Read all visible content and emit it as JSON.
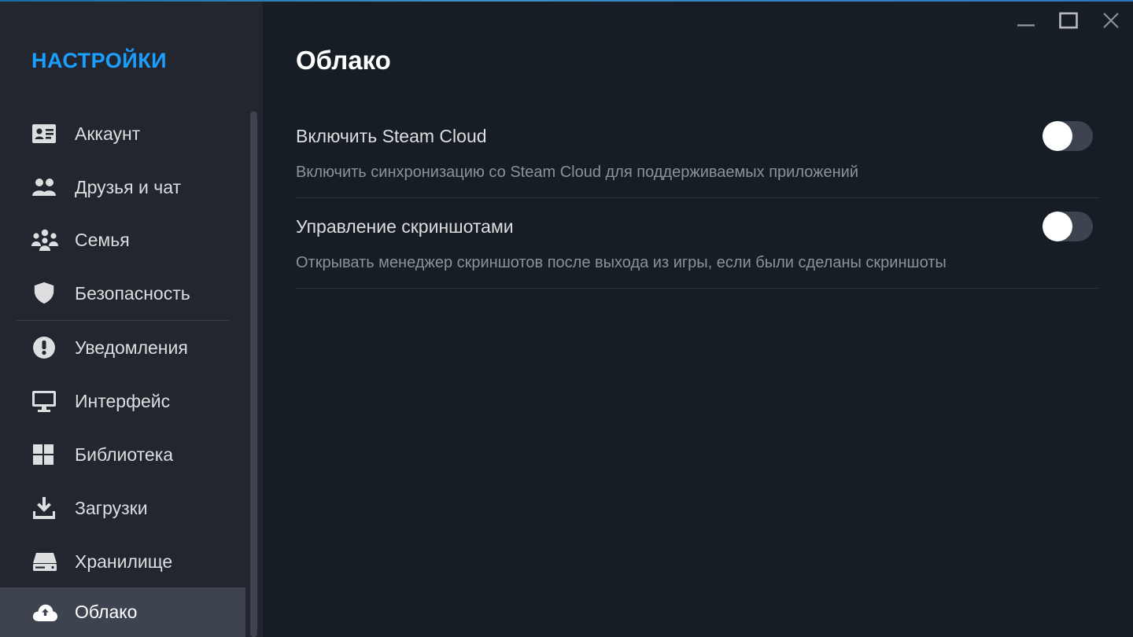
{
  "sidebar": {
    "title": "НАСТРОЙКИ",
    "items": [
      {
        "label": "Аккаунт",
        "icon": "account-card-icon"
      },
      {
        "label": "Друзья и чат",
        "icon": "friends-icon"
      },
      {
        "label": "Семья",
        "icon": "family-icon"
      },
      {
        "label": "Безопасность",
        "icon": "shield-icon"
      },
      {
        "label": "Уведомления",
        "icon": "notification-icon"
      },
      {
        "label": "Интерфейс",
        "icon": "monitor-icon"
      },
      {
        "label": "Библиотека",
        "icon": "grid-icon"
      },
      {
        "label": "Загрузки",
        "icon": "download-icon"
      },
      {
        "label": "Хранилище",
        "icon": "storage-icon"
      },
      {
        "label": "Облако",
        "icon": "cloud-sync-icon",
        "active": true
      }
    ]
  },
  "main": {
    "title": "Облако",
    "settings": [
      {
        "title": "Включить Steam Cloud",
        "description": "Включить синхронизацию со Steam Cloud для поддерживаемых приложений",
        "enabled": false
      },
      {
        "title": "Управление скриншотами",
        "description": "Открывать менеджер скриншотов после выхода из игры, если были сделаны скриншоты",
        "enabled": false
      }
    ]
  },
  "window_controls": {
    "icons": [
      "minimize-icon",
      "maximize-icon",
      "close-icon"
    ]
  },
  "colors": {
    "accent": "#1a9fff",
    "sidebar_bg": "#23262e",
    "main_bg": "#171d25",
    "active_item_bg": "#3d4450",
    "toggle_off_bg": "#3d4450",
    "text_primary": "#dcdedf",
    "text_secondary": "#8b929a"
  }
}
